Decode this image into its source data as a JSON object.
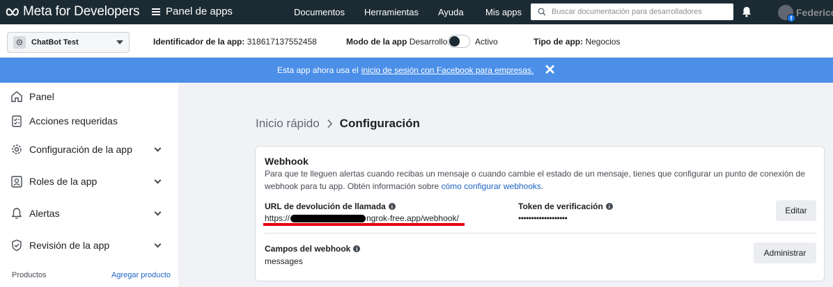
{
  "topbar": {
    "brand": "Meta for Developers",
    "section": "Panel de apps",
    "nav": [
      "Documentos",
      "Herramientas",
      "Ayuda",
      "Mis apps"
    ],
    "search_placeholder": "Buscar documentación para desarrolladores",
    "user_name": "Federico"
  },
  "subheader": {
    "app_name": "ChatBot Test",
    "app_id_label": "Identificador de la app:",
    "app_id": "318617137552458",
    "mode_label": "Modo de la app",
    "mode_off": "Desarrollo",
    "mode_on": "Activo",
    "mode_active": false,
    "type_label": "Tipo de app:",
    "type_value": "Negocios"
  },
  "banner": {
    "text": "Esta app ahora usa el",
    "link": "inicio de sesión con Facebook para empresas."
  },
  "sidebar": {
    "items": [
      {
        "label": "Panel",
        "icon": "home-icon",
        "expandable": false
      },
      {
        "label": "Acciones requeridas",
        "icon": "checklist-icon",
        "expandable": false
      },
      {
        "label": "Configuración de la app",
        "icon": "gear-icon",
        "expandable": true
      },
      {
        "label": "Roles de la app",
        "icon": "user-card-icon",
        "expandable": true
      },
      {
        "label": "Alertas",
        "icon": "bell-icon",
        "expandable": true
      },
      {
        "label": "Revisión de la app",
        "icon": "shield-check-icon",
        "expandable": true
      }
    ],
    "products_label": "Productos",
    "add_product": "Agregar producto"
  },
  "breadcrumb": {
    "parent": "Inicio rápido",
    "current": "Configuración"
  },
  "webhook": {
    "title": "Webhook",
    "description": "Para que te lleguen alertas cuando recibas un mensaje o cuando cambie el estado de un mensaje, tienes que configurar un punto de conexión de webhook para tu app. Obtén información sobre",
    "description_link": "cómo configurar webhooks",
    "callback_label": "URL de devolución de llamada",
    "callback_prefix": "https://",
    "callback_suffix": "ngrok-free.app/webhook/",
    "token_label": "Token de verificación",
    "token_value": "•••••••••••••••••••",
    "edit_button": "Editar",
    "fields_label": "Campos del webhook",
    "fields_value": "messages",
    "manage_button": "Administrar"
  },
  "colors": {
    "topbar": "#1c2b33",
    "banner": "#4b8fe8",
    "link": "#1d64c2",
    "annotation": "#e3000f"
  }
}
